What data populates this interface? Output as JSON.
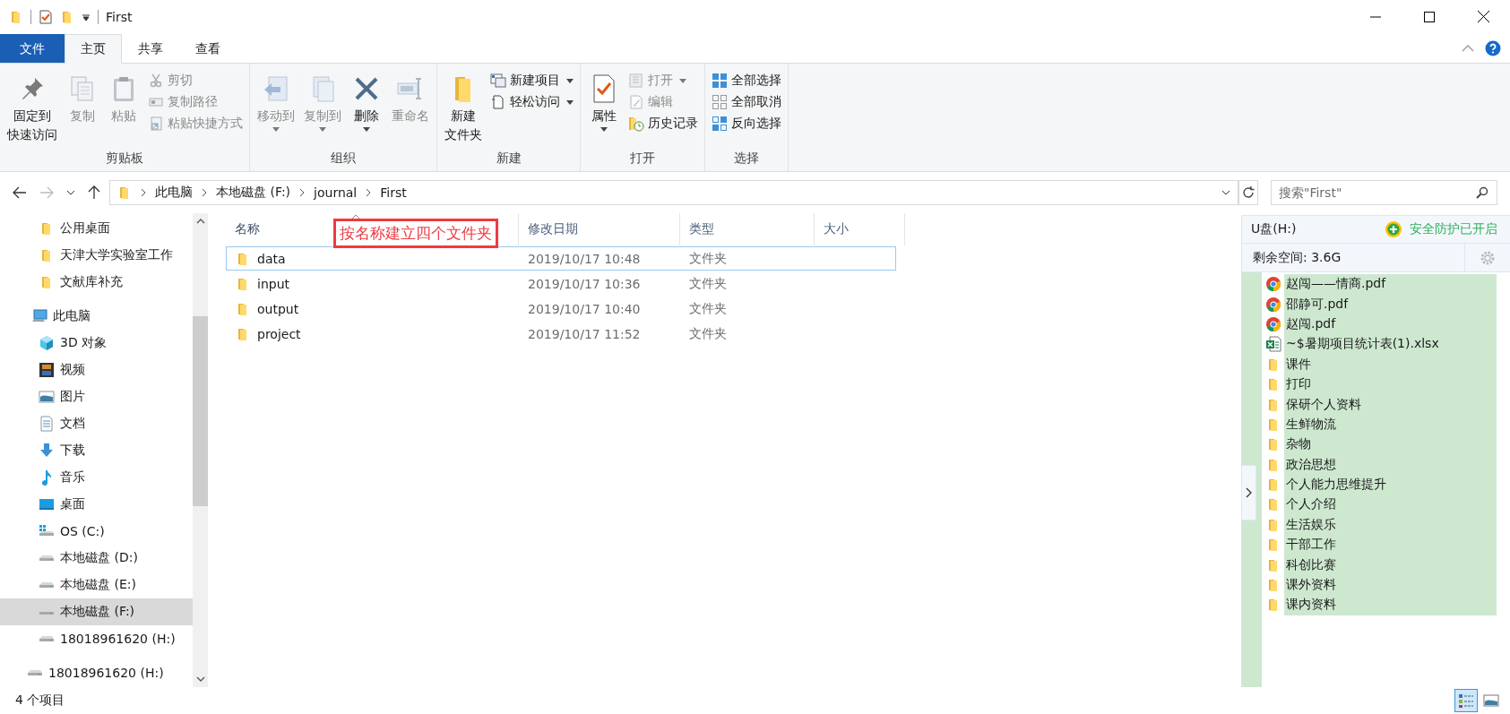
{
  "title_bar": {
    "title": "First"
  },
  "tabs": [
    {
      "label": "文件",
      "kind": "menu",
      "selected": false
    },
    {
      "label": "主页",
      "kind": "tab",
      "selected": true
    },
    {
      "label": "共享",
      "kind": "tab",
      "selected": false
    },
    {
      "label": "查看",
      "kind": "tab",
      "selected": false
    }
  ],
  "ribbon": {
    "groups": [
      {
        "label": "剪贴板",
        "items": [
          {
            "kind": "large",
            "lines": [
              "固定到",
              "快速访问"
            ],
            "disabled": false,
            "dropdown": false
          },
          {
            "kind": "large",
            "label": "复制",
            "disabled": true,
            "dropdown": false
          },
          {
            "kind": "large",
            "label": "粘贴",
            "disabled": true,
            "dropdown": false
          },
          {
            "kind": "small",
            "label": "剪切",
            "disabled": true,
            "dropdown": false
          },
          {
            "kind": "small",
            "label": "复制路径",
            "disabled": true,
            "dropdown": false
          },
          {
            "kind": "small",
            "label": "粘贴快捷方式",
            "disabled": true,
            "dropdown": false
          }
        ]
      },
      {
        "label": "组织",
        "items": [
          {
            "kind": "large",
            "label": "移动到",
            "disabled": true,
            "dropdown": true
          },
          {
            "kind": "large",
            "label": "复制到",
            "disabled": true,
            "dropdown": true
          },
          {
            "kind": "large",
            "label": "删除",
            "disabled": false,
            "dropdown": true
          },
          {
            "kind": "large",
            "label": "重命名",
            "disabled": true,
            "dropdown": false
          }
        ]
      },
      {
        "label": "新建",
        "items": [
          {
            "kind": "large",
            "lines": [
              "新建",
              "文件夹"
            ],
            "disabled": false,
            "dropdown": false
          },
          {
            "kind": "small",
            "label": "新建项目",
            "disabled": false,
            "dropdown": true
          },
          {
            "kind": "small",
            "label": "轻松访问",
            "disabled": false,
            "dropdown": true
          }
        ]
      },
      {
        "label": "打开",
        "items": [
          {
            "kind": "large",
            "label": "属性",
            "disabled": false,
            "dropdown": true
          },
          {
            "kind": "small",
            "label": "打开",
            "disabled": true,
            "dropdown": true
          },
          {
            "kind": "small",
            "label": "编辑",
            "disabled": true,
            "dropdown": false
          },
          {
            "kind": "small",
            "label": "历史记录",
            "disabled": false,
            "dropdown": false
          }
        ]
      },
      {
        "label": "选择",
        "items": [
          {
            "kind": "small",
            "label": "全部选择",
            "disabled": false,
            "dropdown": false
          },
          {
            "kind": "small",
            "label": "全部取消",
            "disabled": false,
            "dropdown": false
          },
          {
            "kind": "small",
            "label": "反向选择",
            "disabled": false,
            "dropdown": false
          }
        ]
      }
    ]
  },
  "address": {
    "crumbs": [
      "此电脑",
      "本地磁盘 (F:)",
      "journal",
      "First"
    ]
  },
  "search": {
    "placeholder": "搜索\"First\""
  },
  "nav": {
    "quick_access": [
      {
        "label": "公用桌面",
        "selected": false
      },
      {
        "label": "天津大学实验室工作",
        "selected": false
      },
      {
        "label": "文献库补充",
        "selected": false
      }
    ],
    "tree": [
      {
        "label": "此电脑",
        "selected": false,
        "children": [
          {
            "label": "3D 对象",
            "selected": false
          },
          {
            "label": "视频",
            "selected": false
          },
          {
            "label": "图片",
            "selected": false
          },
          {
            "label": "文档",
            "selected": false
          },
          {
            "label": "下载",
            "selected": false
          },
          {
            "label": "音乐",
            "selected": false
          },
          {
            "label": "桌面",
            "selected": false
          },
          {
            "label": "OS (C:)",
            "selected": false
          },
          {
            "label": "本地磁盘 (D:)",
            "selected": false
          },
          {
            "label": "本地磁盘 (E:)",
            "selected": false
          },
          {
            "label": "本地磁盘 (F:)",
            "selected": true
          },
          {
            "label": "18018961620 (H:)",
            "selected": false
          }
        ]
      },
      {
        "label": "18018961620 (H:)",
        "selected": false
      }
    ]
  },
  "columns": [
    {
      "label": "名称",
      "sorted": true
    },
    {
      "label": "修改日期",
      "sorted": false
    },
    {
      "label": "类型",
      "sorted": false
    },
    {
      "label": "大小",
      "sorted": false
    }
  ],
  "rows": [
    {
      "name": "data",
      "date": "2019/10/17 10:48",
      "type": "文件夹",
      "focused": true
    },
    {
      "name": "input",
      "date": "2019/10/17 10:36",
      "type": "文件夹",
      "focused": false
    },
    {
      "name": "output",
      "date": "2019/10/17 10:40",
      "type": "文件夹",
      "focused": false
    },
    {
      "name": "project",
      "date": "2019/10/17 11:52",
      "type": "文件夹",
      "focused": false
    }
  ],
  "annotation": {
    "text": "按名称建立四个文件夹"
  },
  "side_panel": {
    "drive": "U盘(H:)",
    "protection": "安全防护已开启",
    "free_space": "剩余空间: 3.6G",
    "items": [
      {
        "name": "赵闯——情商.pdf",
        "kind": "pdf"
      },
      {
        "name": "邵静可.pdf",
        "kind": "pdf"
      },
      {
        "name": "赵闯.pdf",
        "kind": "pdf"
      },
      {
        "name": "~$暑期项目统计表(1).xlsx",
        "kind": "xlsx"
      },
      {
        "name": "课件",
        "kind": "folder"
      },
      {
        "name": "打印",
        "kind": "folder"
      },
      {
        "name": "保研个人资料",
        "kind": "folder"
      },
      {
        "name": "生鲜物流",
        "kind": "folder"
      },
      {
        "name": "杂物",
        "kind": "folder"
      },
      {
        "name": "政治思想",
        "kind": "folder"
      },
      {
        "name": "个人能力思维提升",
        "kind": "folder"
      },
      {
        "name": "个人介绍",
        "kind": "folder"
      },
      {
        "name": "生活娱乐",
        "kind": "folder"
      },
      {
        "name": "干部工作",
        "kind": "folder"
      },
      {
        "name": "科创比赛",
        "kind": "folder"
      },
      {
        "name": "课外资料",
        "kind": "folder"
      },
      {
        "name": "课内资料",
        "kind": "folder"
      }
    ]
  },
  "status_bar": {
    "text": "4 个项目",
    "view_buttons": [
      {
        "selected": true
      },
      {
        "selected": false
      }
    ]
  }
}
